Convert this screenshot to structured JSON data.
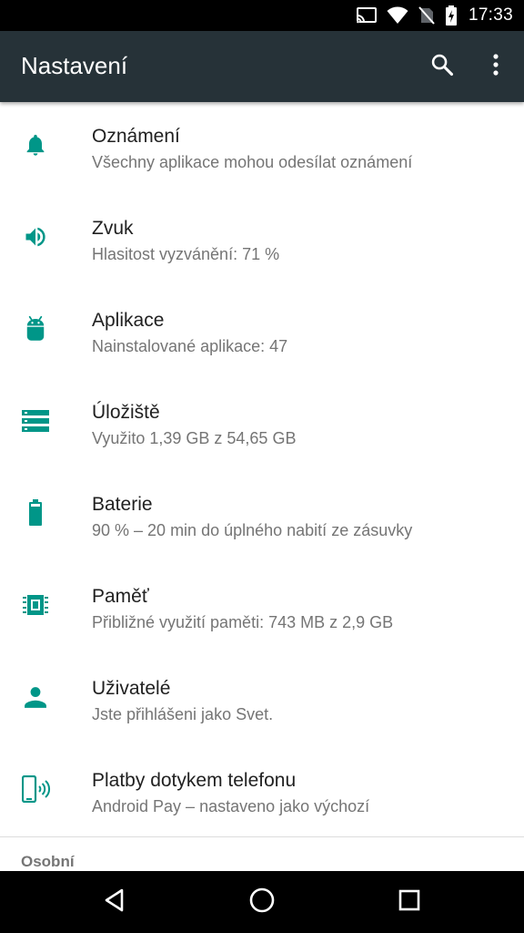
{
  "status_bar": {
    "time": "17:33",
    "icons": [
      "cast-icon",
      "wifi-icon",
      "no-sim-icon",
      "battery-charging-icon"
    ]
  },
  "app_bar": {
    "title": "Nastavení",
    "actions": [
      "search-icon",
      "overflow-menu-icon"
    ]
  },
  "accent_color": "#009688",
  "settings": [
    {
      "icon": "bell-icon",
      "title": "Oznámení",
      "summary": "Všechny aplikace mohou odesílat oznámení"
    },
    {
      "icon": "volume-icon",
      "title": "Zvuk",
      "summary": "Hlasitost vyzvánění: 71 %"
    },
    {
      "icon": "android-icon",
      "title": "Aplikace",
      "summary": "Nainstalované aplikace: 47"
    },
    {
      "icon": "storage-icon",
      "title": "Úložiště",
      "summary": "Využito 1,39 GB z 54,65 GB"
    },
    {
      "icon": "battery-icon",
      "title": "Baterie",
      "summary": "90 % – 20 min do úplného nabití ze zásuvky"
    },
    {
      "icon": "memory-icon",
      "title": "Paměť",
      "summary": "Přibližné využití paměti: 743 MB z 2,9 GB"
    },
    {
      "icon": "person-icon",
      "title": "Uživatelé",
      "summary": "Jste přihlášeni jako Svet."
    },
    {
      "icon": "tap-pay-icon",
      "title": "Platby dotykem telefonu",
      "summary": "Android Pay – nastaveno jako výchozí"
    }
  ],
  "section_header": "Osobní",
  "nav_bar": [
    "back-icon",
    "home-icon",
    "recents-icon"
  ]
}
